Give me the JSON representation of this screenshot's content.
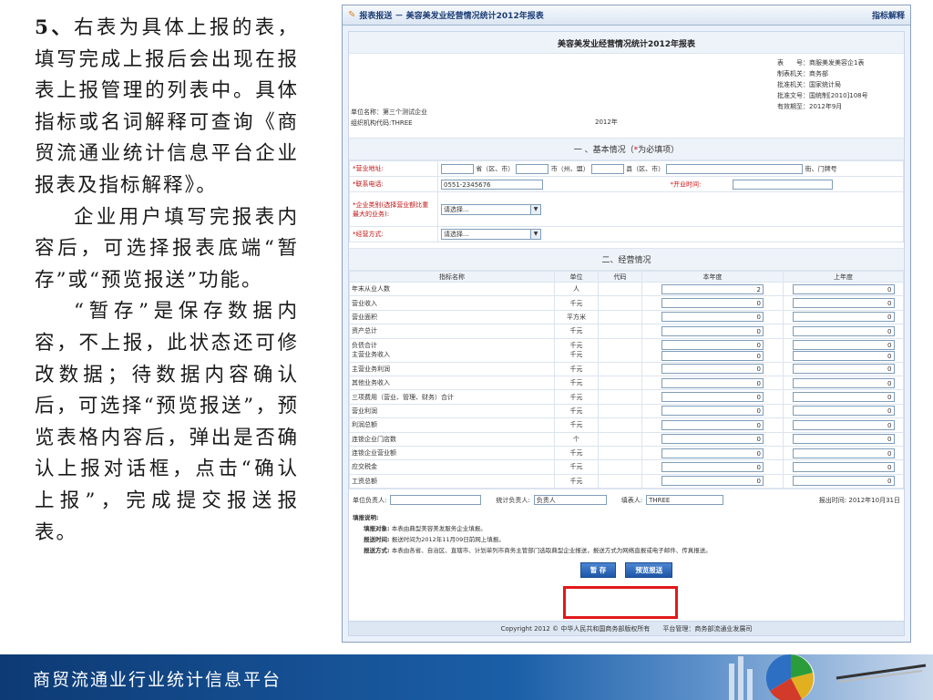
{
  "left_text": {
    "step_num": "5、",
    "para1": "右表为具体上报的表，填写完成上报后会出现在报表上报管理的列表中。具体指标或名词解释可查询《商贸流通业统计信息平台企业报表及指标解释》。",
    "para2": "企业用户填写完报表内容后，可选择报表底端“暂存”或“预览报送”功能。",
    "para3": "“暂存”是保存数据内容，不上报，此状态还可修改数据；待数据内容确认后，可选择“预览报送”，预览表格内容后，弹出是否确认上报对话框，点击“确认上报”，完成提交报送报表。"
  },
  "window": {
    "title": "报表报送 － 美容美发业经营情况统计2012年报表",
    "help_link": "指标解释"
  },
  "report": {
    "title": "美容美发业经营情况统计2012年报表",
    "meta_right": [
      "表　　号：商服美发美容企1表",
      "制表机关：商务部",
      "批准机关：国家统计局",
      "批准文号：国统制[2010]108号",
      "有效期至：2012年9月"
    ],
    "unit_name": "单位名称：第三个测试企业",
    "org_code": "组织机构代码:THREE",
    "year": "2012年"
  },
  "section1": {
    "title": "一 、基本情况（",
    "req": "*",
    "title_tail": "为必填项）"
  },
  "basic": {
    "address_label": "*营业地址:",
    "province": "省（区、市）",
    "city": "市（州、盟）",
    "county": "县（区、市）",
    "street": "街、门牌号",
    "phone_label": "*联系电话:",
    "phone_value": "0551-2345676",
    "open_time_label": "*开业时间:",
    "category_label": "*企业类别(选择营业额比重最大的业务):",
    "select_placeholder": "请选择...",
    "mode_label": "*经营方式:"
  },
  "section2": {
    "title": "二、经营情况"
  },
  "ops_table": {
    "headers": [
      "指标名称",
      "单位",
      "代码",
      "本年度",
      "上年度"
    ],
    "rows": [
      {
        "name": "年末从业人数",
        "unit": "人",
        "cur": "2",
        "prev": "0"
      },
      {
        "name": "营业收入",
        "unit": "千元",
        "cur": "0",
        "prev": "0"
      },
      {
        "name": "营业面积",
        "unit": "平方米",
        "cur": "0",
        "prev": "0"
      },
      {
        "name": "资产总计",
        "unit": "千元",
        "cur": "0",
        "prev": "0"
      },
      {
        "name": "负债合计\n主营业务收入",
        "unit": "千元\n千元",
        "cur": "0\n0",
        "prev": "0\n0"
      },
      {
        "name": "主营业务利润",
        "unit": "千元",
        "cur": "0",
        "prev": "0"
      },
      {
        "name": "其他业务收入",
        "unit": "千元",
        "cur": "0",
        "prev": "0"
      },
      {
        "name": "三项费用（营业、管理、财务）合计",
        "unit": "千元",
        "cur": "0",
        "prev": "0"
      },
      {
        "name": "营业利润",
        "unit": "千元",
        "cur": "0",
        "prev": "0"
      },
      {
        "name": "利润总额",
        "unit": "千元",
        "cur": "0",
        "prev": "0"
      },
      {
        "name": "连锁企业门店数",
        "unit": "个",
        "cur": "0",
        "prev": "0"
      },
      {
        "name": "连锁企业营业额",
        "unit": "千元",
        "cur": "0",
        "prev": "0"
      },
      {
        "name": "应交税金",
        "unit": "千元",
        "cur": "0",
        "prev": "0"
      },
      {
        "name": "工资总额",
        "unit": "千元",
        "cur": "0",
        "prev": "0"
      }
    ]
  },
  "sign": {
    "leader_label": "单位负责人:",
    "stat_leader_label": "统计负责人:",
    "stat_leader_value": "负责人",
    "filler_label": "填表人:",
    "filler_value": "THREE",
    "date": "报出时间: 2012年10月31日"
  },
  "notes": {
    "heading": "填报说明:",
    "line1_b": "填报对象:",
    "line1": "本表由典型美容美发服务企业填报。",
    "line2_b": "报送时间:",
    "line2": "报送时间为2012年11月09日前网上填报。",
    "line3_b": "报送方式:",
    "line3": "本表由各省、自治区、直辖市、计划单列市商务主管部门选取典型企业报送，报送方式为网络直报或电子邮件、传真报送。"
  },
  "buttons": {
    "save": "暂 存",
    "preview": "预览报送"
  },
  "footer": "Copyright 2012 © 中华人民共和国商务部版权所有　　平台管理：商务部流通业发展司",
  "banner": "商贸流通业行业统计信息平台",
  "colors": {
    "banner_dark": "#0d3a74",
    "highlight": "#e0191b",
    "button": "#1e56a8"
  }
}
